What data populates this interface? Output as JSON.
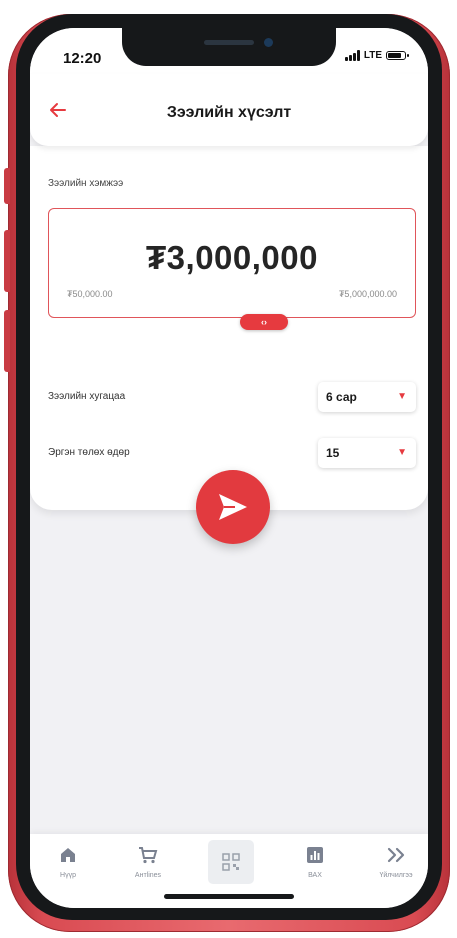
{
  "status_bar": {
    "time": "12:20",
    "network": "LTE"
  },
  "header": {
    "title": "Зээлийн хүсэлт"
  },
  "loan": {
    "amount_label": "Зээлийн хэмжээ",
    "amount": "₮3,000,000",
    "min": "₮50,000.00",
    "max": "₮5,000,000.00",
    "slider_glyph": "‹›",
    "term_label": "Зээлийн хугацаа",
    "term_value": "6 сар",
    "pay_day_label": "Эргэн төлөх өдөр",
    "pay_day_value": "15"
  },
  "nav": {
    "items": [
      {
        "label": "Нүүр",
        "icon": "home-icon"
      },
      {
        "label": "Антlines",
        "icon": "cart-icon"
      },
      {
        "label": "",
        "icon": "qr-icon"
      },
      {
        "label": "ВАХ",
        "icon": "chart-icon"
      },
      {
        "label": "Үйлчилгээ",
        "icon": "chevrons-right-icon"
      }
    ]
  },
  "colors": {
    "accent": "#e23a3f",
    "frame": "#d94b52"
  }
}
